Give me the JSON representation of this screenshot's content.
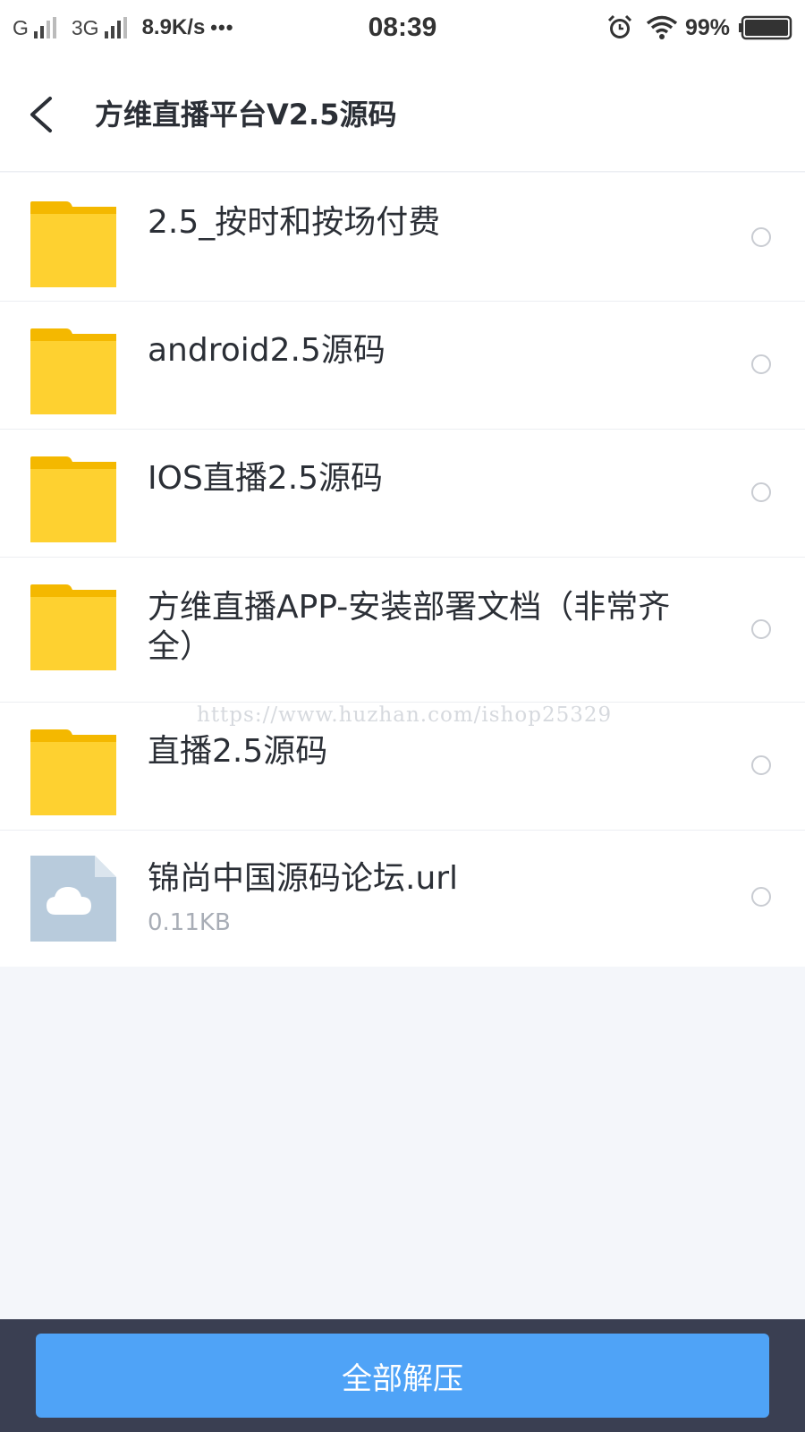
{
  "status_bar": {
    "net1": "G",
    "net2": "3G",
    "speed": "8.9K/s",
    "dots": "•••",
    "time": "08:39",
    "battery": "99%"
  },
  "header": {
    "title": "方维直播平台V2.5源码"
  },
  "files": [
    {
      "name": "2.5_按时和按场付费",
      "type": "folder"
    },
    {
      "name": "android2.5源码",
      "type": "folder"
    },
    {
      "name": "IOS直播2.5源码",
      "type": "folder"
    },
    {
      "name": "方维直播APP-安装部署文档（非常齐全）",
      "type": "folder"
    },
    {
      "name": "直播2.5源码",
      "type": "folder"
    },
    {
      "name": "锦尚中国源码论坛.url",
      "type": "file",
      "size": "0.11KB"
    }
  ],
  "watermark": "https://www.huzhan.com/ishop25329",
  "bottom": {
    "extract_all_label": "全部解压"
  },
  "colors": {
    "folder": "#fed130",
    "folder_tab": "#f4b800",
    "file_icon": "#b8cbdc",
    "button": "#4fa3f7",
    "bottom_bar": "#3a3f52"
  }
}
